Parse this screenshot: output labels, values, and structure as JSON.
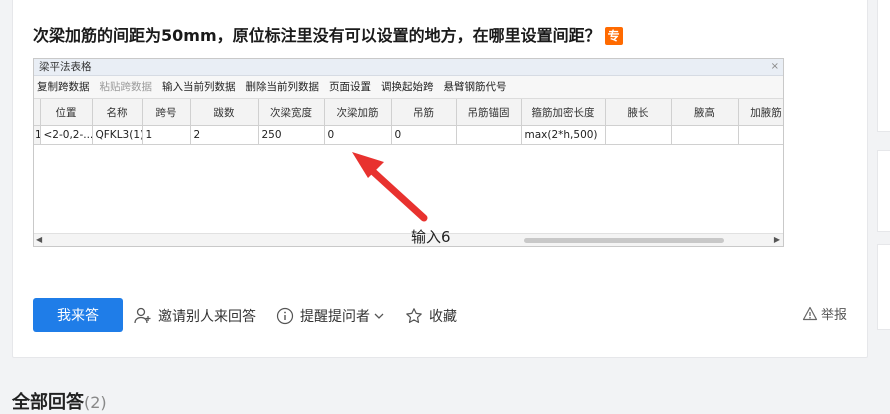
{
  "question": {
    "title": "次梁加筋的间距为50mm，原位标注里没有可以设置的地方，在哪里设置间距？",
    "badge": "专"
  },
  "screenshot": {
    "window_title": "梁平法表格",
    "close": "×",
    "toolbar": [
      "复制跨数据",
      "粘贴跨数据",
      "输入当前列数据",
      "删除当前列数据",
      "页面设置",
      "调换起始跨",
      "悬臂钢筋代号"
    ],
    "toolbar_disabled_index": 1,
    "columns": [
      "",
      "位置",
      "名称",
      "跨号",
      "跋数",
      "次梁宽度",
      "次梁加筋",
      "吊筋",
      "吊筋锚固",
      "箍筋加密长度",
      "腋长",
      "腋高",
      "加腋筋"
    ],
    "row": [
      "1",
      "<2-0,2-...",
      "QFKL3(1)",
      "1",
      "2",
      "250",
      "0",
      "0",
      "",
      "max(2*h,500)",
      "",
      "",
      ""
    ],
    "annotation": "输入6"
  },
  "actions": {
    "answer_button": "我来答",
    "invite": "邀请别人来回答",
    "remind": "提醒提问者",
    "favorite": "收藏",
    "report": "举报"
  },
  "answers_header": {
    "label": "全部回答",
    "count": "(2)"
  },
  "colors": {
    "primary": "#1f7de8",
    "badge": "#ff6a00",
    "arrow": "#e8322f"
  }
}
